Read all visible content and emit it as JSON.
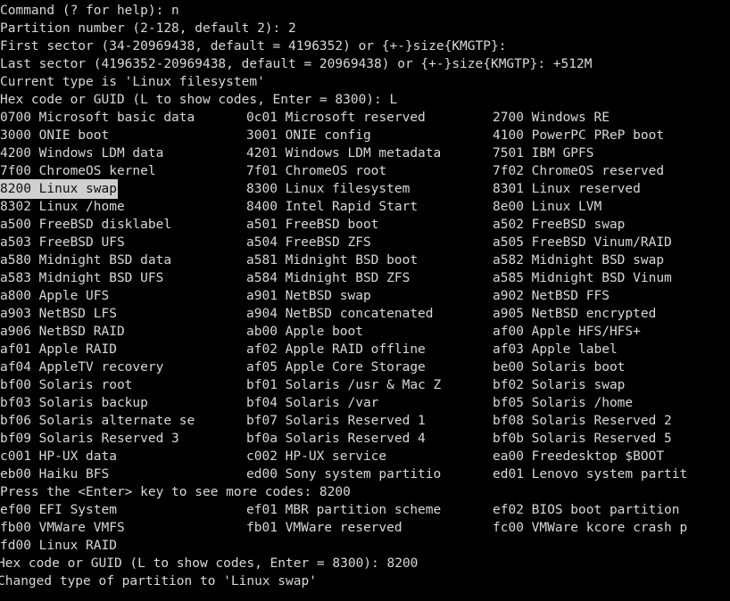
{
  "terminal": {
    "program": "gdisk",
    "colors": {
      "background": "#000000",
      "foreground": "#d8d8d8",
      "highlight_background": "#cfcfcf",
      "highlight_foreground": "#101010"
    },
    "prompt_lines": [
      "Command (? for help): n",
      "Partition number (2-128, default 2): 2",
      "First sector (34-20969438, default = 4196352) or {+-}size{KMGTP}:",
      "Last sector (4196352-20969438, default = 20969438) or {+-}size{KMGTP}: +512M",
      "Current type is 'Linux filesystem'",
      "Hex code or GUID (L to show codes, Enter = 8300): L"
    ],
    "code_table": [
      [
        {
          "code": "0700",
          "name": "Microsoft basic data"
        },
        {
          "code": "0c01",
          "name": "Microsoft reserved"
        },
        {
          "code": "2700",
          "name": "Windows RE"
        }
      ],
      [
        {
          "code": "3000",
          "name": "ONIE boot"
        },
        {
          "code": "3001",
          "name": "ONIE config"
        },
        {
          "code": "4100",
          "name": "PowerPC PReP boot"
        }
      ],
      [
        {
          "code": "4200",
          "name": "Windows LDM data"
        },
        {
          "code": "4201",
          "name": "Windows LDM metadata"
        },
        {
          "code": "7501",
          "name": "IBM GPFS"
        }
      ],
      [
        {
          "code": "7f00",
          "name": "ChromeOS kernel"
        },
        {
          "code": "7f01",
          "name": "ChromeOS root"
        },
        {
          "code": "7f02",
          "name": "ChromeOS reserved"
        }
      ],
      [
        {
          "code": "8200",
          "name": "Linux swap",
          "highlighted": true
        },
        {
          "code": "8300",
          "name": "Linux filesystem"
        },
        {
          "code": "8301",
          "name": "Linux reserved"
        }
      ],
      [
        {
          "code": "8302",
          "name": "Linux /home"
        },
        {
          "code": "8400",
          "name": "Intel Rapid Start"
        },
        {
          "code": "8e00",
          "name": "Linux LVM"
        }
      ],
      [
        {
          "code": "a500",
          "name": "FreeBSD disklabel"
        },
        {
          "code": "a501",
          "name": "FreeBSD boot"
        },
        {
          "code": "a502",
          "name": "FreeBSD swap"
        }
      ],
      [
        {
          "code": "a503",
          "name": "FreeBSD UFS"
        },
        {
          "code": "a504",
          "name": "FreeBSD ZFS"
        },
        {
          "code": "a505",
          "name": "FreeBSD Vinum/RAID"
        }
      ],
      [
        {
          "code": "a580",
          "name": "Midnight BSD data"
        },
        {
          "code": "a581",
          "name": "Midnight BSD boot"
        },
        {
          "code": "a582",
          "name": "Midnight BSD swap"
        }
      ],
      [
        {
          "code": "a583",
          "name": "Midnight BSD UFS"
        },
        {
          "code": "a584",
          "name": "Midnight BSD ZFS"
        },
        {
          "code": "a585",
          "name": "Midnight BSD Vinum"
        }
      ],
      [
        {
          "code": "a800",
          "name": "Apple UFS"
        },
        {
          "code": "a901",
          "name": "NetBSD swap"
        },
        {
          "code": "a902",
          "name": "NetBSD FFS"
        }
      ],
      [
        {
          "code": "a903",
          "name": "NetBSD LFS"
        },
        {
          "code": "a904",
          "name": "NetBSD concatenated"
        },
        {
          "code": "a905",
          "name": "NetBSD encrypted"
        }
      ],
      [
        {
          "code": "a906",
          "name": "NetBSD RAID"
        },
        {
          "code": "ab00",
          "name": "Apple boot"
        },
        {
          "code": "af00",
          "name": "Apple HFS/HFS+"
        }
      ],
      [
        {
          "code": "af01",
          "name": "Apple RAID"
        },
        {
          "code": "af02",
          "name": "Apple RAID offline"
        },
        {
          "code": "af03",
          "name": "Apple label"
        }
      ],
      [
        {
          "code": "af04",
          "name": "AppleTV recovery"
        },
        {
          "code": "af05",
          "name": "Apple Core Storage"
        },
        {
          "code": "be00",
          "name": "Solaris boot"
        }
      ],
      [
        {
          "code": "bf00",
          "name": "Solaris root"
        },
        {
          "code": "bf01",
          "name": "Solaris /usr & Mac Z"
        },
        {
          "code": "bf02",
          "name": "Solaris swap"
        }
      ],
      [
        {
          "code": "bf03",
          "name": "Solaris backup"
        },
        {
          "code": "bf04",
          "name": "Solaris /var"
        },
        {
          "code": "bf05",
          "name": "Solaris /home"
        }
      ],
      [
        {
          "code": "bf06",
          "name": "Solaris alternate se"
        },
        {
          "code": "bf07",
          "name": "Solaris Reserved 1"
        },
        {
          "code": "bf08",
          "name": "Solaris Reserved 2"
        }
      ],
      [
        {
          "code": "bf09",
          "name": "Solaris Reserved 3"
        },
        {
          "code": "bf0a",
          "name": "Solaris Reserved 4"
        },
        {
          "code": "bf0b",
          "name": "Solaris Reserved 5"
        }
      ],
      [
        {
          "code": "c001",
          "name": "HP-UX data"
        },
        {
          "code": "c002",
          "name": "HP-UX service"
        },
        {
          "code": "ea00",
          "name": "Freedesktop $BOOT"
        }
      ],
      [
        {
          "code": "eb00",
          "name": "Haiku BFS"
        },
        {
          "code": "ed00",
          "name": "Sony system partitio"
        },
        {
          "code": "ed01",
          "name": "Lenovo system partit"
        }
      ]
    ],
    "pager_prompt": "Press the <Enter> key to see more codes: 8200",
    "code_table_page2": [
      [
        {
          "code": "ef00",
          "name": "EFI System"
        },
        {
          "code": "ef01",
          "name": "MBR partition scheme"
        },
        {
          "code": "ef02",
          "name": "BIOS boot partition"
        }
      ],
      [
        {
          "code": "fb00",
          "name": "VMWare VMFS"
        },
        {
          "code": "fb01",
          "name": "VMWare reserved"
        },
        {
          "code": "fc00",
          "name": "VMWare kcore crash p"
        }
      ],
      [
        {
          "code": "fd00",
          "name": "Linux RAID"
        }
      ]
    ],
    "trailing_lines": [
      "Hex code or GUID (L to show codes, Enter = 8300): 8200",
      "Changed type of partition to 'Linux swap'"
    ]
  }
}
